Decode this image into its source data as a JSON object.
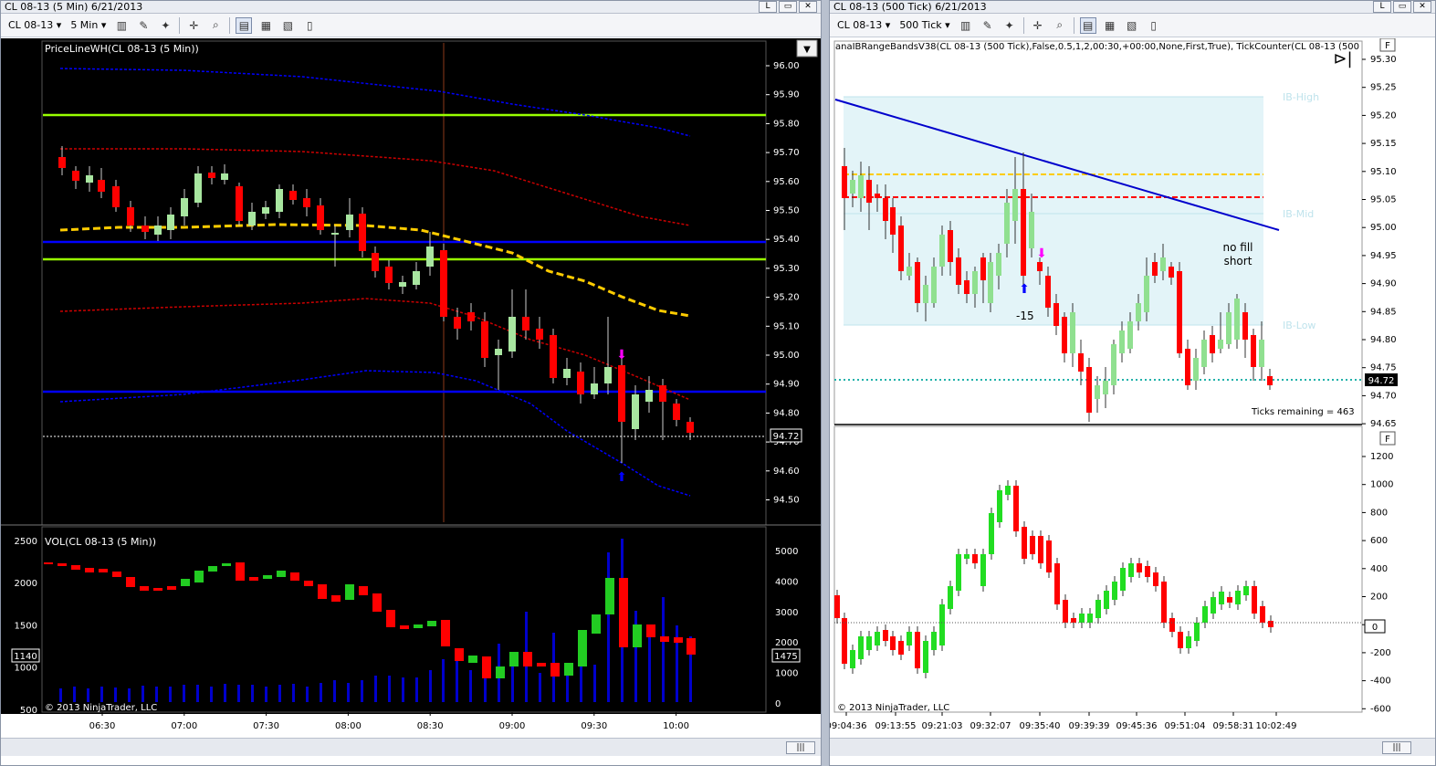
{
  "left": {
    "title": "CL 08-13 (5 Min)  6/21/2013",
    "instrument": "CL 08-13",
    "interval": "5 Min",
    "price_indicator_label": "PriceLineWH(CL 08-13 (5 Min))",
    "price_axis": [
      "96.00",
      "95.90",
      "95.80",
      "95.70",
      "95.60",
      "95.50",
      "95.40",
      "95.30",
      "95.20",
      "95.10",
      "95.00",
      "94.90",
      "94.80",
      "94.70",
      "94.60",
      "94.50"
    ],
    "last_price": "94.72",
    "vol_label": "VOL(CL 08-13 (5 Min))",
    "vol_axis_right": [
      "5000",
      "4000",
      "3000",
      "2000",
      "1000",
      "0"
    ],
    "vol_axis_left": [
      "2500",
      "2000",
      "1500",
      "1000",
      "500"
    ],
    "vol_left_marker": "1140",
    "vol_right_marker": "1475",
    "copyright": "© 2013 NinjaTrader, LLC",
    "time_axis": [
      "06:30",
      "07:00",
      "07:30",
      "08:00",
      "08:30",
      "09:00",
      "09:30",
      "10:00"
    ]
  },
  "right": {
    "title": "CL 08-13 (500 Tick)  6/21/2013",
    "instrument": "CL 08-13",
    "interval": "500 Tick",
    "indicator_label": "anaIBRangeBandsV38(CL 08-13 (500 Tick),False,0.5,1,2,00:30,+00:00,None,First,True), TickCounter(CL 08-13 (500",
    "price_axis": [
      "95.30",
      "95.25",
      "95.20",
      "95.15",
      "95.10",
      "95.05",
      "95.00",
      "94.95",
      "94.90",
      "94.85",
      "94.80",
      "94.75",
      "94.70",
      "94.65"
    ],
    "last_price": "94.72",
    "ib_high": "IB-High",
    "ib_mid": "IB-Mid",
    "ib_low": "IB-Low",
    "annotation_line1": "no fill",
    "annotation_line2": "short",
    "marker_label": "-15",
    "ticks_remaining": "Ticks remaining = 463",
    "lower_axis": [
      "1200",
      "1000",
      "800",
      "600",
      "400",
      "200",
      "0",
      "-200",
      "-400",
      "-600"
    ],
    "lower_zero_marker": "0",
    "copyright": "© 2013 NinjaTrader, LLC",
    "time_axis": [
      "09:04:36",
      "09:13:55",
      "09:21:03",
      "09:32:07",
      "09:35:40",
      "09:39:39",
      "09:45:36",
      "09:51:04",
      "09:58:31",
      "10:02:49"
    ]
  },
  "window_buttons": [
    "L",
    "▭",
    "✕"
  ],
  "colors": {
    "up": "#a8e6a0",
    "down": "#ff0000",
    "vol_up": "#22cc22",
    "blue": "#0000ff",
    "green_line": "#99ff00",
    "yellow": "#ffcc00",
    "ib_fill": "#e3f4f8"
  }
}
